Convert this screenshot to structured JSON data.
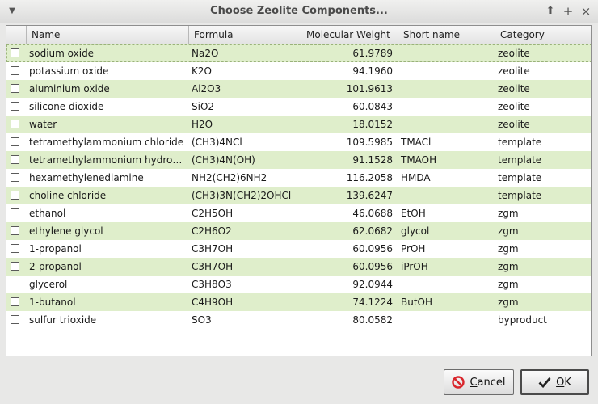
{
  "window": {
    "title": "Choose Zeolite Components...",
    "menu_icon": "chevron-down-icon",
    "buttons": [
      "arrow-up-icon",
      "plus-icon",
      "close-icon"
    ]
  },
  "table": {
    "columns": [
      "",
      "Name",
      "Formula",
      "Molecular Weight",
      "Short name",
      "Category"
    ],
    "rows": [
      {
        "name": "sodium oxide",
        "formula": "Na2O",
        "mw": "61.9789",
        "short": "",
        "category": "zeolite",
        "checked": false
      },
      {
        "name": "potassium oxide",
        "formula": "K2O",
        "mw": "94.1960",
        "short": "",
        "category": "zeolite",
        "checked": false
      },
      {
        "name": "aluminium oxide",
        "formula": "Al2O3",
        "mw": "101.9613",
        "short": "",
        "category": "zeolite",
        "checked": false
      },
      {
        "name": "silicone dioxide",
        "formula": "SiO2",
        "mw": "60.0843",
        "short": "",
        "category": "zeolite",
        "checked": false
      },
      {
        "name": "water",
        "formula": "H2O",
        "mw": "18.0152",
        "short": "",
        "category": "zeolite",
        "checked": false
      },
      {
        "name": "tetramethylammonium chloride",
        "formula": "(CH3)4NCl",
        "mw": "109.5985",
        "short": "TMACl",
        "category": "template",
        "checked": false
      },
      {
        "name": "tetramethylammonium hydro…",
        "formula": "(CH3)4N(OH)",
        "mw": "91.1528",
        "short": "TMAOH",
        "category": "template",
        "checked": false
      },
      {
        "name": "hexamethylenediamine",
        "formula": "NH2(CH2)6NH2",
        "mw": "116.2058",
        "short": "HMDA",
        "category": "template",
        "checked": false
      },
      {
        "name": "choline chloride",
        "formula": "(CH3)3N(CH2)2OHCl",
        "mw": "139.6247",
        "short": "",
        "category": "template",
        "checked": false
      },
      {
        "name": "ethanol",
        "formula": "C2H5OH",
        "mw": "46.0688",
        "short": "EtOH",
        "category": "zgm",
        "checked": false
      },
      {
        "name": "ethylene glycol",
        "formula": "C2H6O2",
        "mw": "62.0682",
        "short": "glycol",
        "category": "zgm",
        "checked": false
      },
      {
        "name": "1-propanol",
        "formula": "C3H7OH",
        "mw": "60.0956",
        "short": "PrOH",
        "category": "zgm",
        "checked": false
      },
      {
        "name": "2-propanol",
        "formula": "C3H7OH",
        "mw": "60.0956",
        "short": "iPrOH",
        "category": "zgm",
        "checked": false
      },
      {
        "name": "glycerol",
        "formula": "C3H8O3",
        "mw": "92.0944",
        "short": "",
        "category": "zgm",
        "checked": false
      },
      {
        "name": "1-butanol",
        "formula": "C4H9OH",
        "mw": "74.1224",
        "short": "ButOH",
        "category": "zgm",
        "checked": false
      },
      {
        "name": "sulfur trioxide",
        "formula": "SO3",
        "mw": "80.0582",
        "short": "",
        "category": "byproduct",
        "checked": false
      }
    ]
  },
  "footer": {
    "cancel_mnemonic": "C",
    "cancel_rest": "ancel",
    "ok_mnemonic": "O",
    "ok_rest": "K",
    "cancel_icon": "cancel-icon",
    "ok_icon": "checkmark-icon"
  },
  "colors": {
    "row_alt": "#dfeecb",
    "cancel_icon": "#d9262c"
  }
}
